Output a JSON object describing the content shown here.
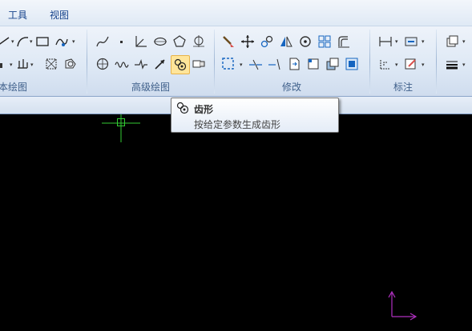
{
  "menubar": {
    "items": [
      "工具",
      "视图"
    ]
  },
  "ribbon": {
    "groups": [
      {
        "label": "本绘图"
      },
      {
        "label": "高级绘图"
      },
      {
        "label": "修改"
      },
      {
        "label": "标注"
      }
    ]
  },
  "tooltip": {
    "title": "齿形",
    "description": "按给定参数生成齿形"
  },
  "colors": {
    "crosshair": "#33cc33",
    "ucs": "#b030c0",
    "canvas": "#000000"
  }
}
